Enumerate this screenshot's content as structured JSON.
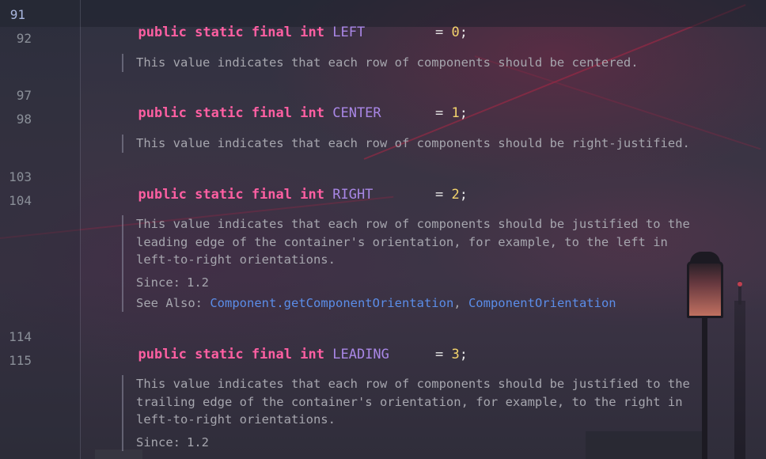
{
  "editor": {
    "line_numbers": {
      "l91": "91",
      "l92": "92",
      "l97": "97",
      "l98": "98",
      "l103": "103",
      "l104": "104",
      "l114": "114",
      "l115": "115"
    },
    "fields": [
      {
        "kw1": "public",
        "kw2": "static",
        "kw3": "final",
        "type": "int",
        "name": "LEFT",
        "eq": "=",
        "value": "0",
        "semi": ";"
      },
      {
        "kw1": "public",
        "kw2": "static",
        "kw3": "final",
        "type": "int",
        "name": "CENTER",
        "eq": "=",
        "value": "1",
        "semi": ";"
      },
      {
        "kw1": "public",
        "kw2": "static",
        "kw3": "final",
        "type": "int",
        "name": "RIGHT",
        "eq": "=",
        "value": "2",
        "semi": ";"
      },
      {
        "kw1": "public",
        "kw2": "static",
        "kw3": "final",
        "type": "int",
        "name": "LEADING",
        "eq": "=",
        "value": "3",
        "semi": ";"
      }
    ],
    "docs": {
      "center": "This value indicates that each row of components should be centered.",
      "right": "This value indicates that each row of components should be right-justified.",
      "leading": "This value indicates that each row of components should be justified to the\nleading edge of the container's orientation, for example, to the left in\nleft-to-right orientations.",
      "leading_since_label": "Since:",
      "leading_since_value": "1.2",
      "leading_see_also_label": "See Also:",
      "leading_link1": "Component.getComponentOrientation",
      "leading_sep": ", ",
      "leading_link2": "ComponentOrientation",
      "trailing": "This value indicates that each row of components should be justified to the\ntrailing edge of the container's orientation, for example, to the right in\nleft-to-right orientations.",
      "trailing_since_label": "Since:",
      "trailing_since_value": "1.2"
    }
  },
  "colors": {
    "keyword": "#ff5fa2",
    "constant": "#a987e6",
    "number": "#f3d46c",
    "doc_text": "#a6a6ae",
    "link": "#5b8de8"
  }
}
